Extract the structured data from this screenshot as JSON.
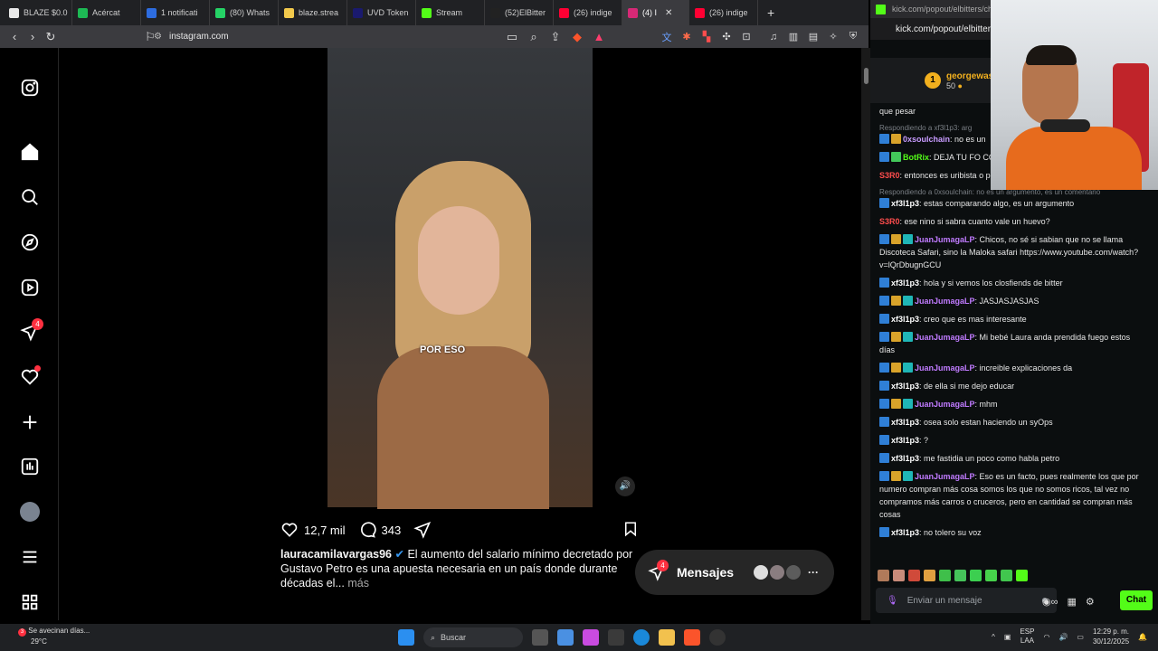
{
  "browser": {
    "tabs": [
      {
        "label": "BLAZE $0.0",
        "color": "#e8e8e8",
        "icon": "blaze-icon",
        "active": false
      },
      {
        "label": "Acércat",
        "color": "#1db954",
        "icon": "spotify-icon",
        "active": false
      },
      {
        "label": "1 notificati",
        "color": "#2d6cdf",
        "icon": "notification-icon",
        "active": false
      },
      {
        "label": "(80) Whats",
        "color": "#25d366",
        "icon": "whatsapp-icon",
        "active": false
      },
      {
        "label": "blaze.strea",
        "color": "#f2c94c",
        "icon": "blaze-stream-icon",
        "active": false
      },
      {
        "label": "UVD Token",
        "color": "#1a1a6e",
        "icon": "token-icon",
        "active": false
      },
      {
        "label": "Stream",
        "color": "#53fc18",
        "icon": "kick-icon",
        "active": false
      },
      {
        "label": "(52)ElBitter",
        "color": "#222222",
        "icon": "tiktok-icon",
        "active": false
      },
      {
        "label": "(26) indige",
        "color": "#ff0033",
        "icon": "youtube-icon",
        "active": false
      },
      {
        "label": "(4) I",
        "color": "#d62976",
        "icon": "instagram-icon",
        "active": true
      },
      {
        "label": "(26) indige",
        "color": "#ff0033",
        "icon": "youtube-icon",
        "active": false
      }
    ],
    "new_tab": "+",
    "url": "instagram.com"
  },
  "instagram": {
    "video_caption": "POR ESO",
    "likes": "12,7 mil",
    "comments": "343",
    "post_username": "lauracamilavargas96",
    "post_text": " El aumento del salario mínimo decretado por Gustavo Petro es una apuesta necesaria en un país donde durante décadas el...",
    "more_label": " más",
    "notifications_badge": "4",
    "messages_label": "Mensajes",
    "messages_badge": "4"
  },
  "kick": {
    "url_top": "kick.com/popout/elbitters/chat",
    "url_bar": "kick.com/popout/elbitten",
    "pinned_user": "georgewash",
    "pinned_amount": "50",
    "messages": [
      {
        "reply": "",
        "user": "",
        "color": "#e8e8e8",
        "badges": [],
        "text": "que pesar"
      },
      {
        "reply": "Respondiendo a xf3l1p3: arg",
        "user": "0xsoulchain",
        "color": "#c89bff",
        "badges": [
          "b1",
          "b2"
        ],
        "text": ": no es un"
      },
      {
        "reply": "",
        "user": "BotRix",
        "color": "#53fc18",
        "badges": [
          "b1",
          "b4"
        ],
        "text": ": DEJA TU FO CONTENIDO"
      },
      {
        "reply": "",
        "user": "S3R0",
        "color": "#ff4d4d",
        "badges": [],
        "text": ": entonces es uribista o petrista?"
      },
      {
        "reply": "Respondiendo a 0xsoulchain: no es un argumento, es un comentario",
        "user": "xf3l1p3",
        "color": "#ffffff",
        "badges": [
          "b1"
        ],
        "text": ": estas comparando algo, es un argumento"
      },
      {
        "reply": "",
        "user": "S3R0",
        "color": "#ff4d4d",
        "badges": [],
        "text": ": ese nino si sabra cuanto vale un huevo?"
      },
      {
        "reply": "",
        "user": "JuanJumagaLP",
        "color": "#c07bff",
        "badges": [
          "b1",
          "b2",
          "b3"
        ],
        "text": ": Chicos, no sé si sabian que no se llama Discoteca Safari, sino la Maloka safari https://www.youtube.com/watch?v=lQrDbugnGCU"
      },
      {
        "reply": "",
        "user": "xf3l1p3",
        "color": "#ffffff",
        "badges": [
          "b1"
        ],
        "text": ": hola y si vemos los closfiends de bitter"
      },
      {
        "reply": "",
        "user": "JuanJumagaLP",
        "color": "#c07bff",
        "badges": [
          "b1",
          "b2",
          "b3"
        ],
        "text": ": JASJASJASJAS"
      },
      {
        "reply": "",
        "user": "xf3l1p3",
        "color": "#ffffff",
        "badges": [
          "b1"
        ],
        "text": ": creo que es mas interesante"
      },
      {
        "reply": "",
        "user": "JuanJumagaLP",
        "color": "#c07bff",
        "badges": [
          "b1",
          "b2",
          "b3"
        ],
        "text": ": Mi bebé Laura anda prendida fuego estos días"
      },
      {
        "reply": "",
        "user": "JuanJumagaLP",
        "color": "#c07bff",
        "badges": [
          "b1",
          "b2",
          "b3"
        ],
        "text": ": increible explicaciones da"
      },
      {
        "reply": "",
        "user": "xf3l1p3",
        "color": "#ffffff",
        "badges": [
          "b1"
        ],
        "text": ": de ella si me dejo educar"
      },
      {
        "reply": "",
        "user": "JuanJumagaLP",
        "color": "#c07bff",
        "badges": [
          "b1",
          "b2",
          "b3"
        ],
        "text": ": mhm"
      },
      {
        "reply": "",
        "user": "xf3l1p3",
        "color": "#ffffff",
        "badges": [
          "b1"
        ],
        "text": ": osea solo estan haciendo un syOps"
      },
      {
        "reply": "",
        "user": "xf3l1p3",
        "color": "#ffffff",
        "badges": [
          "b1"
        ],
        "text": ": ?"
      },
      {
        "reply": "",
        "user": "xf3l1p3",
        "color": "#ffffff",
        "badges": [
          "b1"
        ],
        "text": ": me fastidia un poco como habla petro"
      },
      {
        "reply": "",
        "user": "JuanJumagaLP",
        "color": "#c07bff",
        "badges": [
          "b1",
          "b2",
          "b3"
        ],
        "text": ": Eso es un facto, pues realmente los que por numero compran más cosa somos los que no somos ricos, tal vez no compramos más carros o cruceros, pero en cantidad se compran más cosas"
      },
      {
        "reply": "",
        "user": "xf3l1p3",
        "color": "#ffffff",
        "badges": [
          "b1"
        ],
        "text": ": no tolero su voz"
      }
    ],
    "input_placeholder": "Enviar un mensaje",
    "chat_button": "Chat"
  },
  "taskbar": {
    "weather_text": "Se avecinan días...",
    "weather_temp": "29°C",
    "weather_badge": "3",
    "search_label": "Buscar",
    "lang": "ESP",
    "lang_region": "LAA",
    "time": "12:29 p. m.",
    "date": "30/12/2025"
  }
}
